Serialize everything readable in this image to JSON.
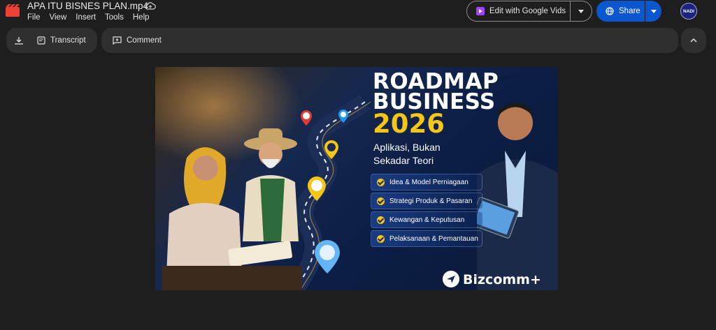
{
  "document": {
    "title": "APA ITU BISNES PLAN.mp4"
  },
  "menu": [
    "File",
    "View",
    "Insert",
    "Tools",
    "Help"
  ],
  "header": {
    "edit_vids_label": "Edit with Google Vids",
    "share_label": "Share",
    "avatar_text": "NADI"
  },
  "toolbar": {
    "transcript_label": "Transcript",
    "comment_label": "Comment"
  },
  "video": {
    "title_line1": "ROADMAP",
    "title_line2": "BUSINESS",
    "year": "2026",
    "subtitle": "Aplikasi, Bukan Sekadar Teori",
    "checklist": [
      "Idea & Model Perniagaan",
      "Strategi Produk & Pasaran",
      "Kewangan & Keputusan",
      "Pelaksanaan & Pemantauan"
    ],
    "brand": "Bizcomm+",
    "corner_brand": "BizComm+"
  },
  "colors": {
    "background": "#1e1e1e",
    "toolbar": "#2f2f2f",
    "share": "#0b57d0",
    "accent_yellow": "#f5c518",
    "vids_purple": "#a142f4"
  }
}
